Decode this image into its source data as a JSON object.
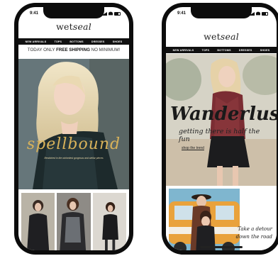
{
  "phones": [
    {
      "status_time": "9:41",
      "brand": {
        "prefix": "wet",
        "suffix": "seal"
      },
      "nav": [
        "NEW ARRIVALS",
        "TOPS",
        "BOTTOMS",
        "DRESSES",
        "SHOES"
      ],
      "promo_banner": {
        "prefix": "TODAY ONLY ",
        "highlight": "FREE SHIPPING",
        "suffix": " NO MINIMUM!"
      },
      "hero": {
        "headline": "spellbound",
        "tagline": "Bewitched in the wickedest gorgeous and stellar pieces"
      }
    },
    {
      "status_time": "9:41",
      "brand": {
        "prefix": "wet",
        "suffix": "seal"
      },
      "nav": [
        "NEW ARRIVALS",
        "TOPS",
        "BOTTOMS",
        "DRESSES",
        "SHOES"
      ],
      "hero": {
        "headline": "Wanderlust",
        "subline": "getting there is half the fun",
        "cta": "shop the trend"
      },
      "promo": {
        "line1": "Take a detour",
        "line2": "down the road"
      }
    }
  ],
  "colors": {
    "phone_frame": "#0c0c0c",
    "nav_bar": "#111111",
    "headline_gold": "#d8b25a"
  }
}
